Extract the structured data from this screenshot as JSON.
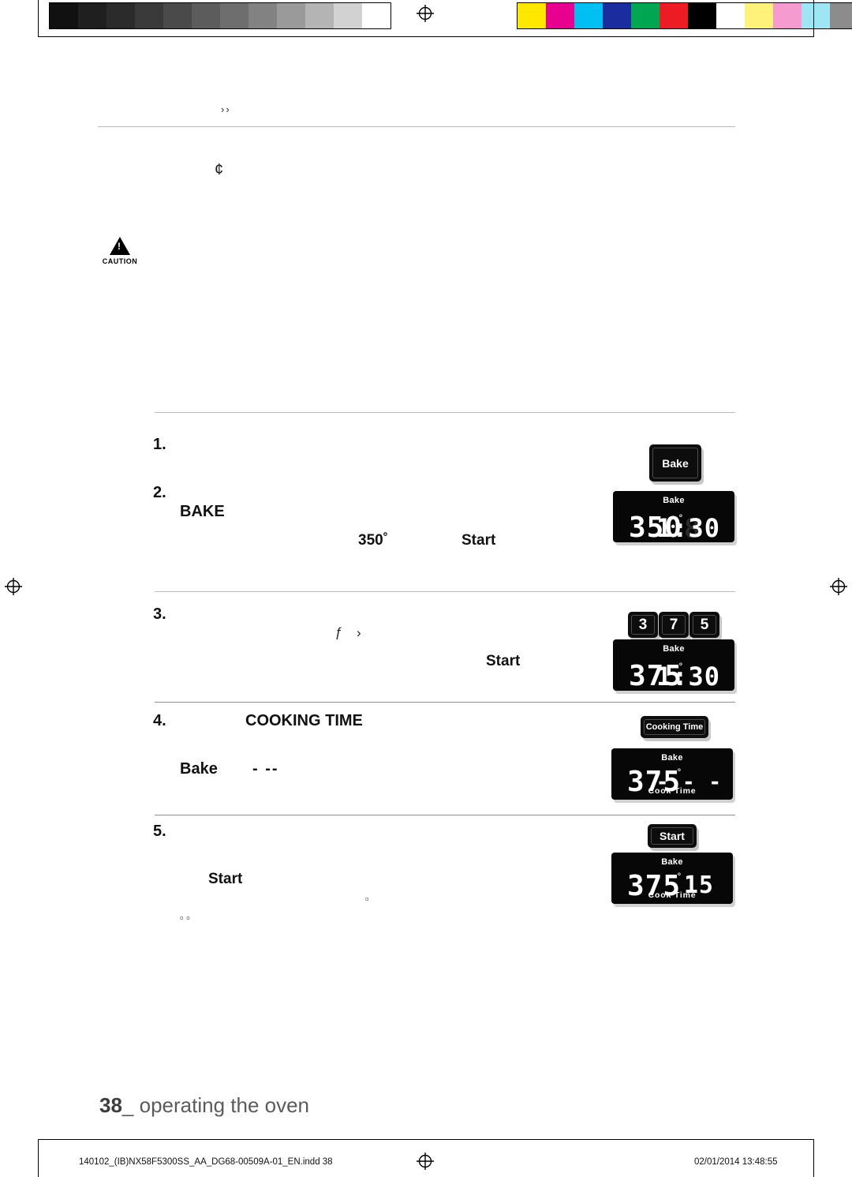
{
  "document": {
    "folio_number": "38",
    "folio_text": "operating the oven",
    "folio_separator": "_",
    "imprint_left": "140102_(IB)NX58F5300SS_AA_DG68-00509A-01_EN.indd   38",
    "imprint_right": "02/01/2014   13:48:55"
  },
  "marks": {
    "chevron": "››",
    "cent_symbol": "¢",
    "caution_label": "CAUTION",
    "caution_glyph": "!",
    "small_glyph_f": "ƒ",
    "small_glyph_chev": "›",
    "tiny_square": "▫",
    "tiny_squares": "▫ ▫"
  },
  "steps": [
    {
      "number": "1.",
      "label": ""
    },
    {
      "number": "2.",
      "label": "BAKE",
      "value": "350˚",
      "action": "Start"
    },
    {
      "number": "3.",
      "label": "",
      "action": "Start"
    },
    {
      "number": "4.",
      "label": "COOKING TIME",
      "sub_label": "Bake",
      "dashes": "- --"
    },
    {
      "number": "5.",
      "label": "",
      "action": "Start"
    }
  ],
  "keycaps": [
    {
      "id": "bake-key",
      "label": "Bake"
    },
    {
      "id": "digit-3-key",
      "label": "3"
    },
    {
      "id": "digit-7-key",
      "label": "7"
    },
    {
      "id": "digit-5-key",
      "label": "5"
    },
    {
      "id": "cooking-time-key",
      "label": "Cooking Time"
    },
    {
      "id": "start-key",
      "label": "Start"
    }
  ],
  "displays": [
    {
      "id": "display-step-2",
      "mode": "Bake",
      "temperature": "350",
      "degree": "˚",
      "ghost": "8",
      "time": "1:30",
      "sub": ""
    },
    {
      "id": "display-step-3",
      "mode": "Bake",
      "temperature": "375",
      "degree": "˚",
      "ghost": "",
      "time": "1:30",
      "sub": ""
    },
    {
      "id": "display-step-4",
      "mode": "Bake",
      "temperature": "375",
      "degree": "˚",
      "ghost": "",
      "time": "- - -",
      "sub": "Cook  Time"
    },
    {
      "id": "display-step-5",
      "mode": "Bake",
      "temperature": "375",
      "degree": "˚",
      "ghost": "",
      "time": "15",
      "sub": "Cook  Time"
    }
  ],
  "calibration": {
    "grayscale": [
      "#111111",
      "#1f1f1f",
      "#2b2b2b",
      "#3a3a3a",
      "#4a4a4a",
      "#5c5c5c",
      "#6e6e6e",
      "#828282",
      "#9a9a9a",
      "#b4b4b4",
      "#d2d2d2",
      "#ffffff"
    ],
    "colors": [
      "#ffe800",
      "#e8008f",
      "#00bff3",
      "#1b2d9e",
      "#00a651",
      "#ed1c24",
      "#000000",
      "#ffffff",
      "#fff27a",
      "#f59bd0",
      "#9fe6f5",
      "#8c8c8c"
    ]
  }
}
